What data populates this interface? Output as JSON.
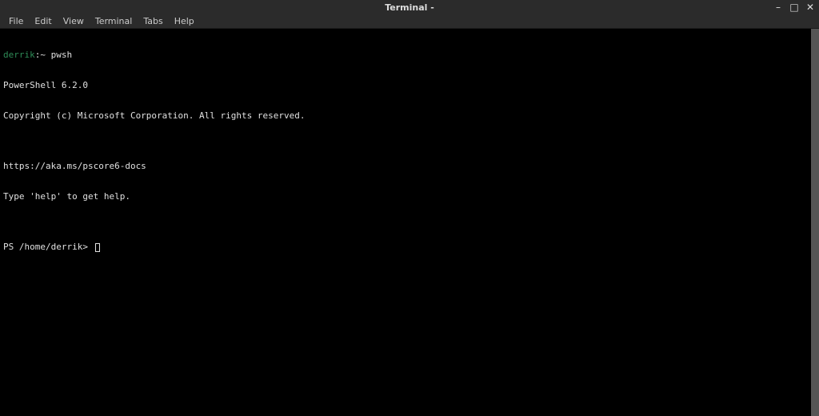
{
  "titlebar": {
    "title": "Terminal -"
  },
  "window_controls": {
    "minimize": "–",
    "maximize": "□",
    "close": "✕"
  },
  "menubar": {
    "file": "File",
    "edit": "Edit",
    "view": "View",
    "terminal": "Terminal",
    "tabs": "Tabs",
    "help": "Help"
  },
  "terminal": {
    "line1_user": "derrik",
    "line1_sep": ":~",
    "line1_cmd": " pwsh",
    "line2": "PowerShell 6.2.0",
    "line3": "Copyright (c) Microsoft Corporation. All rights reserved.",
    "line4": "",
    "line5": "https://aka.ms/pscore6-docs",
    "line6": "Type 'help' to get help.",
    "line7": "",
    "line8_prompt": "PS /home/derrik> "
  }
}
